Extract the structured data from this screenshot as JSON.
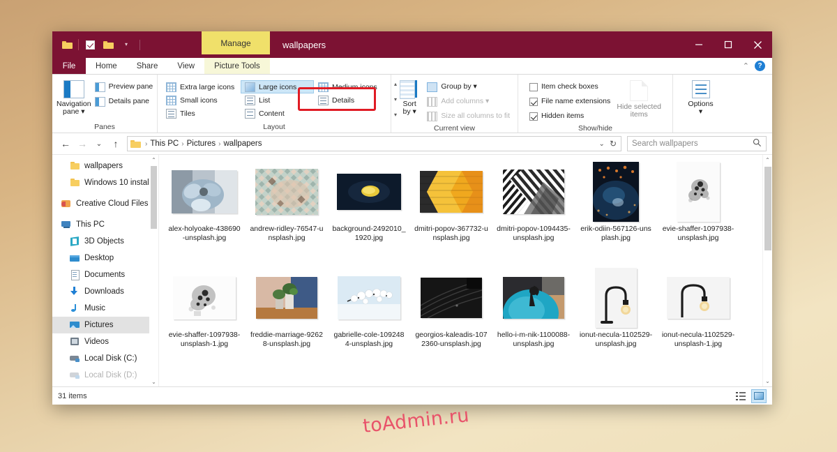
{
  "window": {
    "title": "wallpapers",
    "contextual_tab": "Manage",
    "minimize": "minimize",
    "maximize": "maximize",
    "close": "close"
  },
  "quick_access": {
    "folder_icon": "folder-icon",
    "properties_icon": "properties-checkbox-icon",
    "new_folder_icon": "new-folder-icon",
    "customize_caret": "▾"
  },
  "tabs": [
    {
      "label": "File",
      "id": "file"
    },
    {
      "label": "Home",
      "id": "home"
    },
    {
      "label": "Share",
      "id": "share"
    },
    {
      "label": "View",
      "id": "view"
    },
    {
      "label": "Picture Tools",
      "id": "picture-tools"
    }
  ],
  "tabstrip_right": {
    "collapse_ribbon": "⌃",
    "help": "?"
  },
  "ribbon": {
    "groups": [
      {
        "name": "Panes",
        "label": "Panes",
        "navigation_pane": "Navigation\npane",
        "navigation_pane_line1": "Navigation",
        "navigation_pane_line2": "pane ▾",
        "items": [
          {
            "label": "Preview pane",
            "dim": false
          },
          {
            "label": "Details pane",
            "dim": false
          }
        ]
      },
      {
        "name": "Layout",
        "label": "Layout",
        "items": [
          {
            "label": "Extra large icons",
            "selected": false
          },
          {
            "label": "Small icons",
            "selected": false
          },
          {
            "label": "Tiles",
            "selected": false
          },
          {
            "label": "Large icons",
            "selected": true
          },
          {
            "label": "List",
            "selected": false
          },
          {
            "label": "Content",
            "selected": false
          },
          {
            "label": "Medium icons",
            "selected": false
          },
          {
            "label": "Details",
            "selected": false,
            "highlighted": true
          }
        ],
        "scroll_up": "▴",
        "scroll_down": "▾",
        "expand": "▾"
      },
      {
        "name": "Current view",
        "label": "Current view",
        "sort_by_line1": "Sort",
        "sort_by_line2": "by ▾",
        "items": [
          {
            "label": "Group by ▾",
            "dim": false
          },
          {
            "label": "Add columns ▾",
            "dim": true
          },
          {
            "label": "Size all columns to fit",
            "dim": true
          }
        ]
      },
      {
        "name": "Show/hide",
        "label": "Show/hide",
        "checkboxes": [
          {
            "label": "Item check boxes",
            "checked": false
          },
          {
            "label": "File name extensions",
            "checked": true
          },
          {
            "label": "Hidden items",
            "checked": true
          }
        ],
        "hide_selected_line1": "Hide selected",
        "hide_selected_line2": "items"
      },
      {
        "name": "Options",
        "label": "",
        "options_line1": "Options",
        "options_line2": "▾"
      }
    ],
    "highlight_color": "#e01b24"
  },
  "address_bar": {
    "back_icon": "←",
    "forward_icon": "→",
    "recent_icon": "⌄",
    "up_icon": "↑",
    "breadcrumbs": [
      "This PC",
      "Pictures",
      "wallpapers"
    ],
    "separator": "›",
    "dropdown_icon": "⌄",
    "refresh_icon": "↻",
    "search_placeholder": "Search wallpapers",
    "search_value": "",
    "search_icon": "⌕"
  },
  "sidebar": {
    "items": [
      {
        "label": "wallpapers",
        "icon": "folder-icon",
        "indent": 2,
        "selected": false
      },
      {
        "label": "Windows 10 install",
        "icon": "folder-icon",
        "indent": 2,
        "selected": false
      },
      {
        "label": "Creative Cloud Files",
        "icon": "creative-cloud-icon",
        "indent": 1,
        "selected": false
      },
      {
        "label": "This PC",
        "icon": "this-pc-icon",
        "indent": 1,
        "selected": false
      },
      {
        "label": "3D Objects",
        "icon": "3d-objects-icon",
        "indent": 2,
        "selected": false
      },
      {
        "label": "Desktop",
        "icon": "desktop-icon",
        "indent": 2,
        "selected": false
      },
      {
        "label": "Documents",
        "icon": "documents-icon",
        "indent": 2,
        "selected": false
      },
      {
        "label": "Downloads",
        "icon": "downloads-icon",
        "indent": 2,
        "selected": false
      },
      {
        "label": "Music",
        "icon": "music-icon",
        "indent": 2,
        "selected": false
      },
      {
        "label": "Pictures",
        "icon": "pictures-icon",
        "indent": 2,
        "selected": true
      },
      {
        "label": "Videos",
        "icon": "videos-icon",
        "indent": 2,
        "selected": false
      },
      {
        "label": "Local Disk (C:)",
        "icon": "disk-icon",
        "indent": 2,
        "selected": false
      },
      {
        "label": "Local Disk (D:)",
        "icon": "disk-icon",
        "indent": 2,
        "selected": false
      }
    ],
    "scroll_up": "⌃",
    "scroll_down": "⌄"
  },
  "files": [
    {
      "name": "alex-holyoake-438690-unsplash.jpg",
      "thumb": "flower-blue",
      "orientation": "landscape"
    },
    {
      "name": "andrew-ridley-76547-unsplash.jpg",
      "thumb": "mosaic-tiles",
      "orientation": "landscape"
    },
    {
      "name": "background-2492010_1920.jpg",
      "thumb": "dark-yellow-light",
      "orientation": "landscape"
    },
    {
      "name": "dmitri-popov-367732-unsplash.jpg",
      "thumb": "yellow-arrow",
      "orientation": "landscape"
    },
    {
      "name": "dmitri-popov-1094435-unsplash.jpg",
      "thumb": "bw-stripes",
      "orientation": "landscape"
    },
    {
      "name": "erik-odiin-567126-unsplash.jpg",
      "thumb": "night-city",
      "orientation": "portrait"
    },
    {
      "name": "evie-shaffer-1097938-unsplash.jpg",
      "thumb": "ink-splash",
      "orientation": "portrait"
    },
    {
      "name": "evie-shaffer-1097938-unsplash-1.jpg",
      "thumb": "ink-splash",
      "orientation": "landscape"
    },
    {
      "name": "freddie-marriage-92628-unsplash.jpg",
      "thumb": "plants-vases",
      "orientation": "landscape"
    },
    {
      "name": "gabrielle-cole-1092484-unsplash.jpg",
      "thumb": "blossom-branch",
      "orientation": "landscape"
    },
    {
      "name": "georgios-kaleadis-1072360-unsplash.jpg",
      "thumb": "dark-texture",
      "orientation": "landscape"
    },
    {
      "name": "hello-i-m-nik-1100088-unsplash.jpg",
      "thumb": "blue-globe",
      "orientation": "landscape"
    },
    {
      "name": "ionut-necula-1102529-unsplash.jpg",
      "thumb": "lamp-desk",
      "orientation": "portrait"
    },
    {
      "name": "ionut-necula-1102529-unsplash-1.jpg",
      "thumb": "lamp-wall",
      "orientation": "landscape"
    }
  ],
  "status_bar": {
    "item_count": "31 items",
    "details_view_icon": "details-view-icon",
    "large_icons_view_icon": "large-icons-view-icon"
  },
  "watermark": {
    "text": "toAdmin.ru",
    "color": "#e8536a"
  }
}
